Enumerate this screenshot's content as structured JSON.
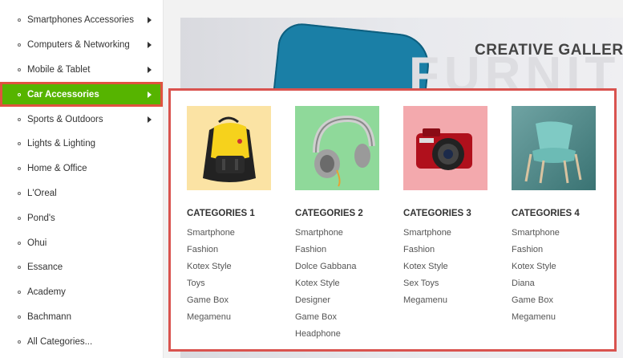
{
  "sidebar": {
    "items": [
      {
        "label": "Smartphones Accessories",
        "has_sub": true
      },
      {
        "label": "Computers & Networking",
        "has_sub": true
      },
      {
        "label": "Mobile & Tablet",
        "has_sub": true
      },
      {
        "label": "Car Accessories",
        "has_sub": true,
        "active": true
      },
      {
        "label": "Sports & Outdoors",
        "has_sub": true
      },
      {
        "label": "Lights & Lighting"
      },
      {
        "label": "Home & Office"
      },
      {
        "label": "L'Oreal"
      },
      {
        "label": "Pond's"
      },
      {
        "label": "Ohui"
      },
      {
        "label": "Essance"
      },
      {
        "label": "Academy"
      },
      {
        "label": "Bachmann"
      },
      {
        "label": "All Categories..."
      }
    ]
  },
  "banner": {
    "title": "CREATIVE GALLERY",
    "background_word": "FURNITU"
  },
  "mega_menu": {
    "columns": [
      {
        "title": "CATEGORIES 1",
        "image": "yellow-backpack",
        "image_bg": "#fbe3a4",
        "links": [
          "Smartphone",
          "Fashion",
          "Kotex Style",
          "Toys",
          "Game Box",
          "Megamenu"
        ]
      },
      {
        "title": "CATEGORIES 2",
        "image": "headphones",
        "image_bg": "#8fd99a",
        "links": [
          "Smartphone",
          "Fashion",
          "Dolce Gabbana",
          "Kotex Style",
          "Designer",
          "Game Box",
          "Headphone"
        ]
      },
      {
        "title": "CATEGORIES 3",
        "image": "red-camera",
        "image_bg": "#f3a9ad",
        "links": [
          "Smartphone",
          "Fashion",
          "Kotex Style",
          "Sex Toys",
          "Megamenu"
        ]
      },
      {
        "title": "CATEGORIES 4",
        "image": "teal-armchair",
        "image_bg": "#4e8a8c",
        "links": [
          "Smartphone",
          "Fashion",
          "Kotex Style",
          "Diana",
          "Game Box",
          "Megamenu"
        ]
      }
    ]
  },
  "colors": {
    "active_bg": "#56b400",
    "highlight_border": "#d9534f"
  }
}
